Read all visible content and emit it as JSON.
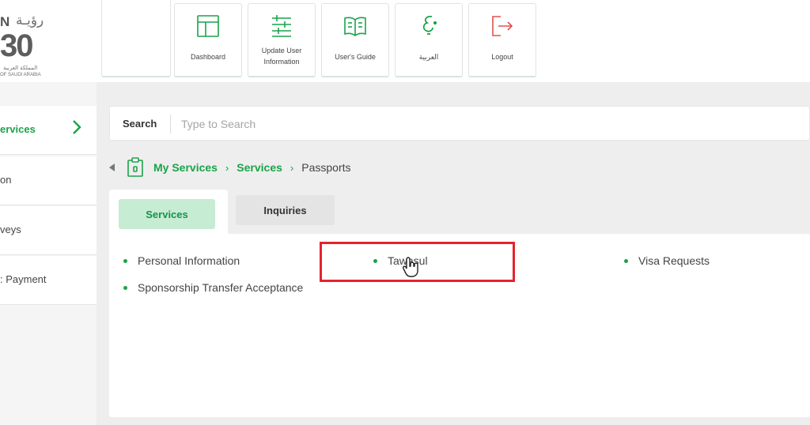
{
  "logo": {
    "arabic": "رؤيـة",
    "letter": "N",
    "number": "30",
    "sub_ar": "المملكة العربية",
    "sub_en": "OF SAUDI ARABIA"
  },
  "nav": {
    "dashboard": "Dashboard",
    "update_user_info": "Update User Information",
    "users_guide": "User's Guide",
    "arabic": "العربية",
    "logout": "Logout"
  },
  "sidebar": {
    "items": [
      {
        "label": "ervices"
      },
      {
        "label": "on"
      },
      {
        "label": "veys"
      },
      {
        "label": ": Payment"
      }
    ]
  },
  "search": {
    "label": "Search",
    "placeholder": "Type to Search"
  },
  "breadcrumb": {
    "items": [
      "My Services",
      "Services",
      "Passports"
    ]
  },
  "tabs": {
    "services": "Services",
    "inquiries": "Inquiries"
  },
  "services": [
    "Personal Information",
    "Tawasul",
    "Visa Requests",
    "Sponsorship Transfer Acceptance"
  ],
  "colors": {
    "accent": "#1aa34a",
    "highlight": "#e3242b"
  }
}
